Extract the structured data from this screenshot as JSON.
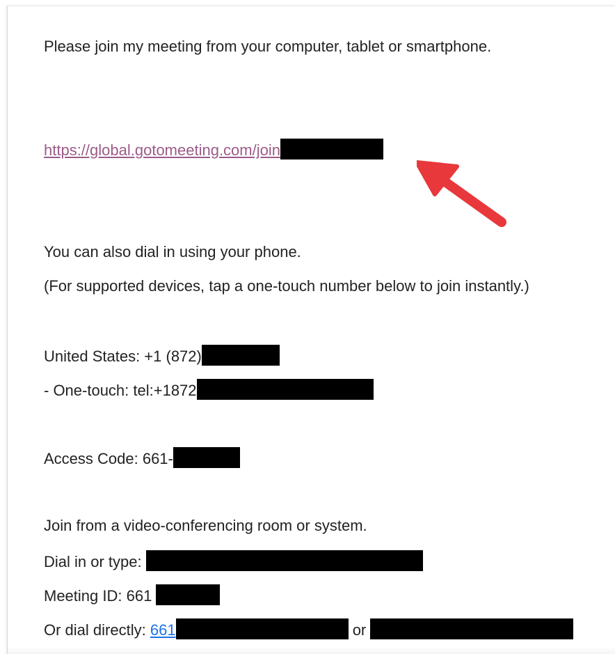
{
  "invite": {
    "intro": "Please join my meeting from your computer, tablet or smartphone.",
    "join_link": "https://global.gotomeeting.com/join",
    "phone_intro": "You can also dial in using your phone.",
    "phone_note": "(For supported devices, tap a one-touch number below to join instantly.)",
    "us_label": "United States: +1 (872)",
    "one_touch_label": "- One-touch: tel:+1872",
    "access_code_label": "Access Code: 661-",
    "video_intro": "Join from a video-conferencing room or system.",
    "dial_type_label": "Dial in or type:",
    "meeting_id_label": "Meeting ID: 661",
    "dial_directly_label": "Or dial directly:",
    "dial_directly_link": "661",
    "or_text": "or"
  },
  "annotation": {
    "arrow_icon": "red-arrow-icon",
    "arrow_color": "#e8383b"
  },
  "colors": {
    "visited_link": "#9b5b88",
    "link": "#1a73e8",
    "redaction": "#000000"
  }
}
